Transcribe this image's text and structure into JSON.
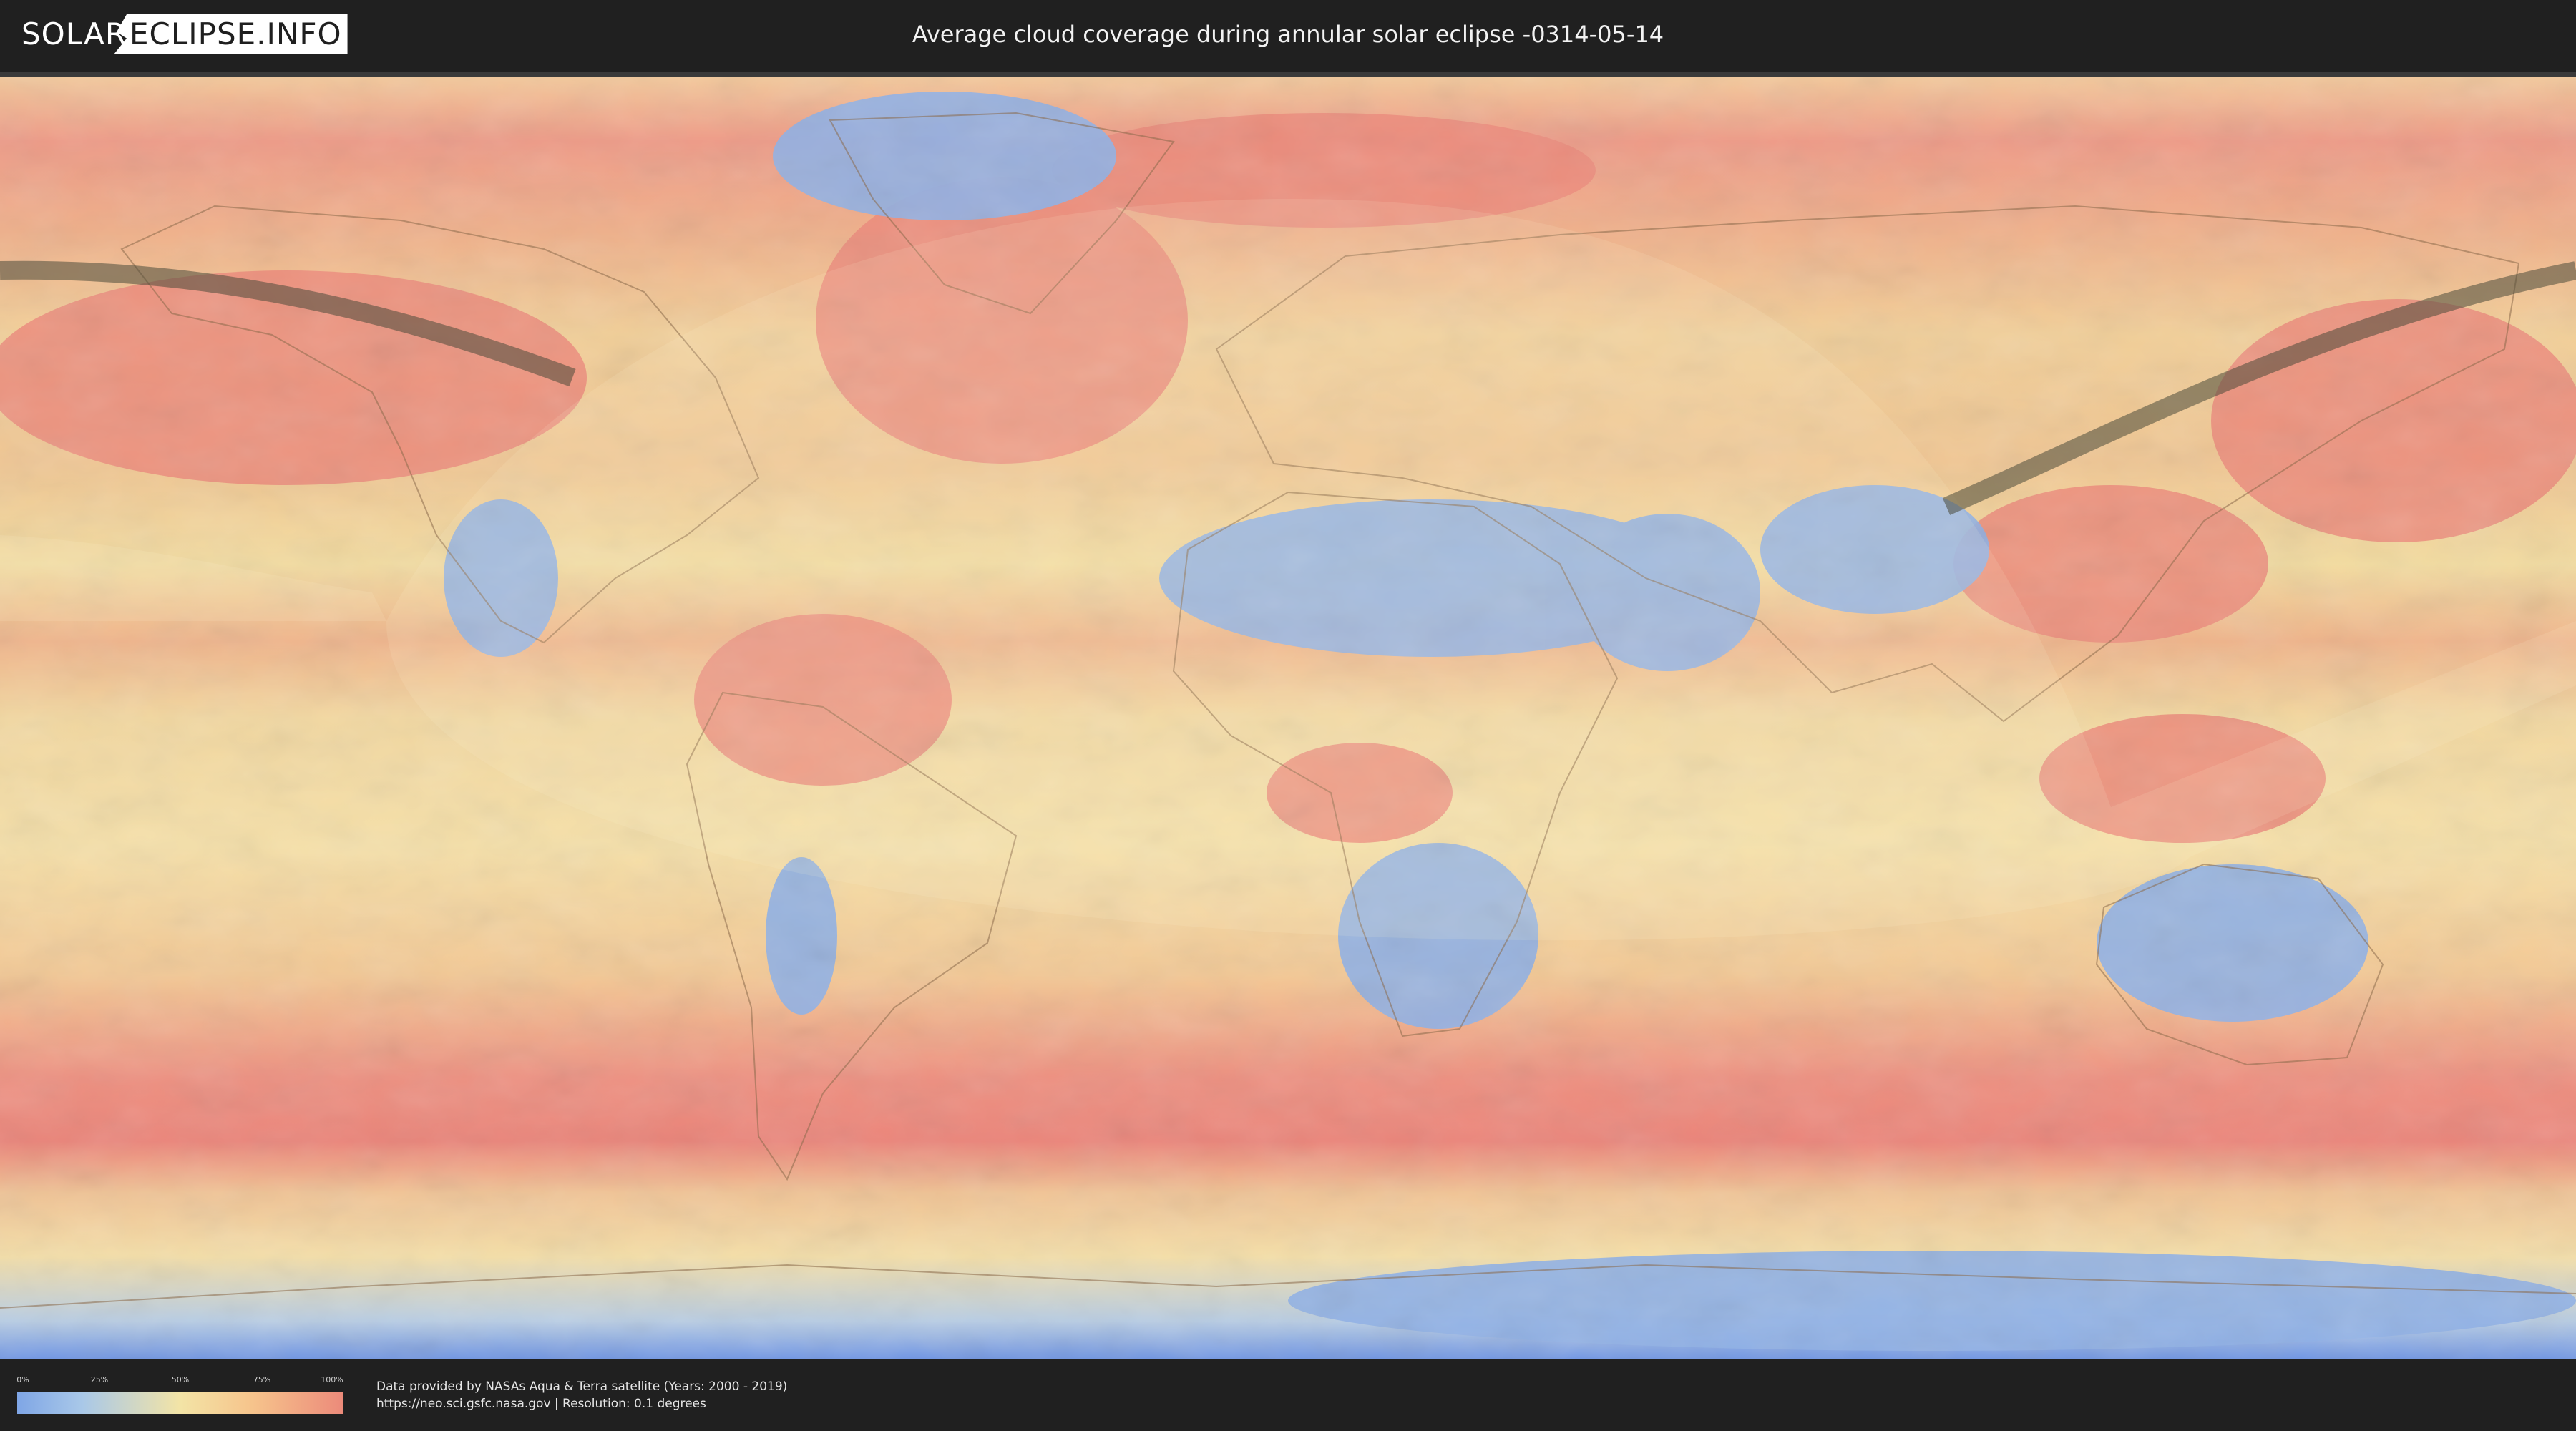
{
  "header": {
    "logo_left": "SOLAR",
    "logo_right": "ECLIPSE.INFO",
    "title": "Average cloud coverage during annular solar eclipse -0314-05-14"
  },
  "map": {
    "type": "world cloud coverage map (equirectangular)",
    "colors": {
      "clear": "#7fa6e6",
      "low": "#a9c8e8",
      "mid": "#f3e4a6",
      "high": "#f6c48c",
      "overcast": "#ec8a7a",
      "eclipse_path": "#4a4a3a",
      "visibility_overlay": "#fff6d5"
    }
  },
  "legend": {
    "ticks": [
      "0%",
      "25%",
      "50%",
      "75%",
      "100%"
    ]
  },
  "footer": {
    "credit_line1": "Data provided by NASAs Aqua & Terra satellite (Years: 2000 - 2019)",
    "credit_line2": "https://neo.sci.gsfc.nasa.gov | Resolution: 0.1 degrees"
  }
}
